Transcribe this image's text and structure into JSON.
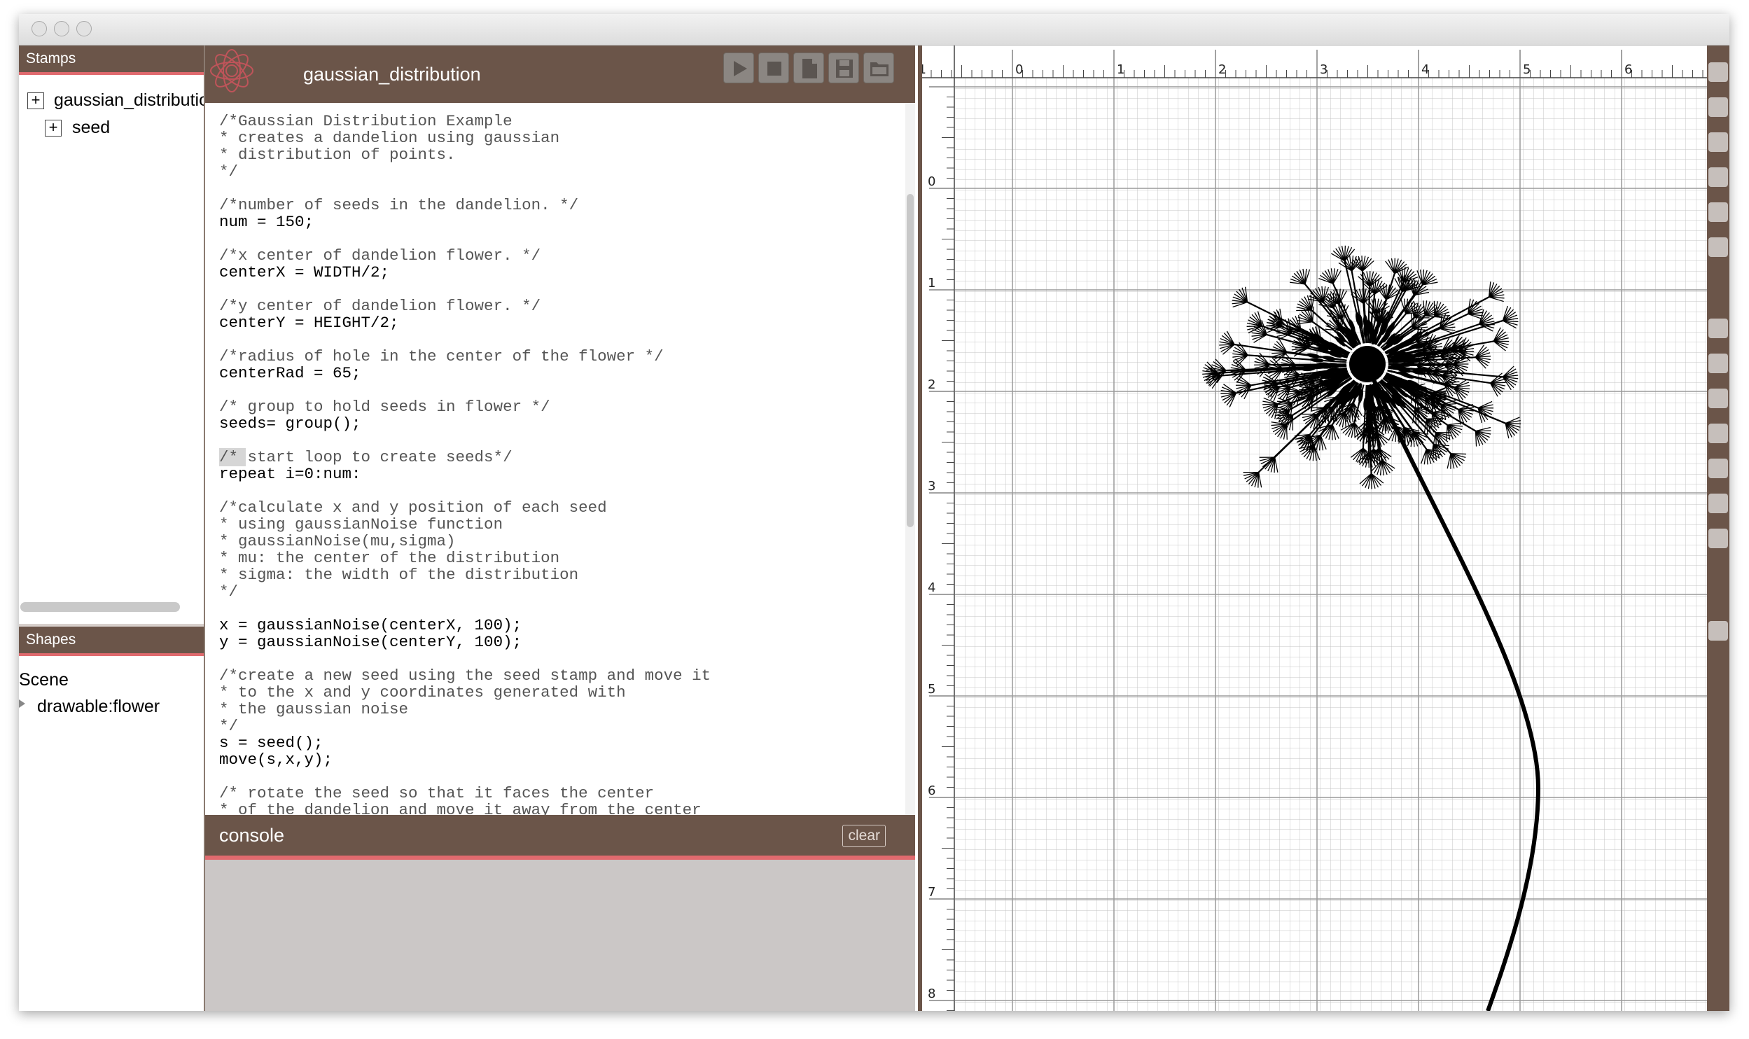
{
  "stamps_panel": {
    "title": "Stamps",
    "items": [
      {
        "label": "gaussian_distribution",
        "expander": "+"
      },
      {
        "label": "seed",
        "expander": "+"
      }
    ]
  },
  "shapes_panel": {
    "title": "Shapes",
    "scene_label": "Scene",
    "items": [
      {
        "label": "drawable:flower"
      }
    ]
  },
  "editor": {
    "title": "gaussian_distribution",
    "toolbar": [
      "play-icon",
      "stop-icon",
      "new-file-icon",
      "save-icon",
      "open-folder-icon"
    ],
    "code_lines": [
      "/*Gaussian Distribution Example",
      "* creates a dandelion using gaussian",
      "* distribution of points.",
      "*/",
      "",
      "/*number of seeds in the dandelion. */",
      "num = 150;",
      "",
      "/*x center of dandelion flower. */",
      "centerX = WIDTH/2;",
      "",
      "/*y center of dandelion flower. */",
      "centerY = HEIGHT/2;",
      "",
      "/*radius of hole in the center of the flower */",
      "centerRad = 65;",
      "",
      "/* group to hold seeds in flower */",
      "seeds= group();",
      "",
      "/* start loop to create seeds*/",
      "repeat i=0:num:",
      "",
      "/*calculate x and y position of each seed",
      "* using gaussianNoise function",
      "* gaussianNoise(mu,sigma)",
      "* mu: the center of the distribution",
      "* sigma: the width of the distribution",
      "*/",
      "",
      "x = gaussianNoise(centerX, 100);",
      "y = gaussianNoise(centerY, 100);",
      "",
      "/*create a new seed using the seed stamp and move it",
      "* to the x and y coordinates generated with",
      "* the gaussian noise",
      "*/",
      "s = seed();",
      "move(s,x,y);",
      "",
      "/* rotate the seed so that it faces the center",
      "* of the dandelion and move it away from the center"
    ]
  },
  "console": {
    "title": "console",
    "clear_label": "clear"
  },
  "canvas": {
    "ruler_top_labels": [
      "-1",
      "0",
      "1",
      "2",
      "3",
      "4",
      "5",
      "6"
    ],
    "ruler_left_labels": [
      "0",
      "1",
      "2",
      "3",
      "4",
      "5",
      "6",
      "7",
      "8"
    ]
  },
  "tools": [
    "select-arrow-icon",
    "hand-icon",
    "zoom-icon",
    "target-icon",
    "grid-icon",
    "frame-icon",
    "rectangle-icon",
    "ellipse-icon",
    "polygon-icon",
    "line-icon",
    "curve-icon",
    "star-icon",
    "pen-icon",
    "print-icon"
  ],
  "colors": {
    "chrome_brown": "#6b5549",
    "accent_red": "#e06a6e",
    "console_bg": "#cbc7c6"
  }
}
